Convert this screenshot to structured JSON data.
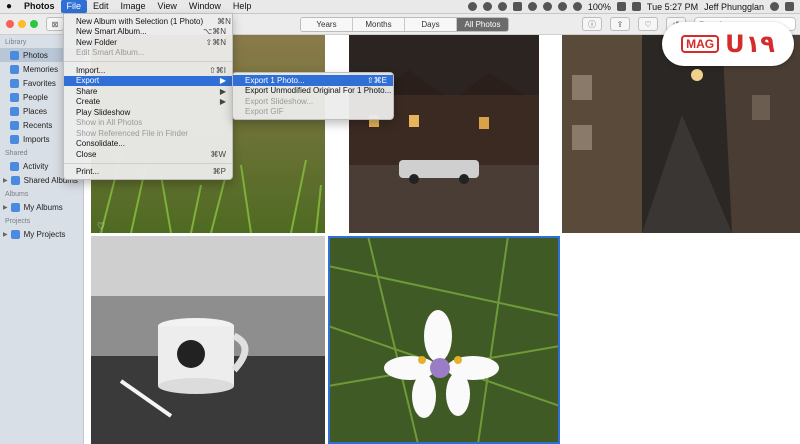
{
  "menubar": {
    "app_name": "Photos",
    "menus": [
      "File",
      "Edit",
      "Image",
      "View",
      "Window",
      "Help"
    ],
    "battery": "100%",
    "clock": "Tue 5:27 PM",
    "user": "Jeff Phungglan"
  },
  "toolbar": {
    "view_tabs": [
      "Years",
      "Months",
      "Days",
      "All Photos"
    ],
    "selected_tab": "All Photos",
    "search_placeholder": "Search"
  },
  "sidebar": {
    "library_heading": "Library",
    "library_items": [
      {
        "label": "Photos",
        "icon": "photos-icon",
        "selected": true
      },
      {
        "label": "Memories",
        "icon": "memories-icon"
      },
      {
        "label": "Favorites",
        "icon": "heart-icon"
      },
      {
        "label": "People",
        "icon": "people-icon"
      },
      {
        "label": "Places",
        "icon": "places-icon"
      },
      {
        "label": "Recents",
        "icon": "clock-icon"
      },
      {
        "label": "Imports",
        "icon": "imports-icon"
      }
    ],
    "shared_heading": "Shared",
    "shared_items": [
      {
        "label": "Activity",
        "icon": "cloud-icon"
      },
      {
        "label": "Shared Albums",
        "icon": "folder-icon",
        "expandable": true
      }
    ],
    "albums_heading": "Albums",
    "albums_items": [
      {
        "label": "My Albums",
        "icon": "folder-icon",
        "expandable": true
      }
    ],
    "projects_heading": "Projects",
    "projects_items": [
      {
        "label": "My Projects",
        "icon": "folder-icon",
        "expandable": true
      }
    ]
  },
  "file_menu": {
    "items": [
      {
        "label": "New Album with Selection (1 Photo)",
        "shortcut": "⌘N"
      },
      {
        "label": "New Smart Album...",
        "shortcut": "⌥⌘N"
      },
      {
        "label": "New Folder",
        "shortcut": "⇧⌘N"
      },
      {
        "label": "Edit Smart Album...",
        "shortcut": "",
        "disabled": true
      },
      {
        "separator": true
      },
      {
        "label": "Import...",
        "shortcut": "⇧⌘I"
      },
      {
        "label": "Export",
        "shortcut": "▶",
        "highlighted": true
      },
      {
        "label": "Share",
        "shortcut": "▶"
      },
      {
        "label": "Create",
        "shortcut": "▶"
      },
      {
        "label": "Play Slideshow",
        "shortcut": ""
      },
      {
        "label": "Show in All Photos",
        "shortcut": "",
        "disabled": true
      },
      {
        "label": "Show Referenced File in Finder",
        "shortcut": "",
        "disabled": true
      },
      {
        "label": "Consolidate...",
        "shortcut": ""
      },
      {
        "label": "Close",
        "shortcut": "⌘W"
      },
      {
        "separator": true
      },
      {
        "label": "Print...",
        "shortcut": "⌘P"
      }
    ]
  },
  "export_submenu": {
    "items": [
      {
        "label": "Export 1 Photo...",
        "shortcut": "⇧⌘E",
        "highlighted": true
      },
      {
        "label": "Export Unmodified Original For 1 Photo...",
        "shortcut": ""
      },
      {
        "label": "Export Slideshow...",
        "shortcut": "",
        "disabled": true
      },
      {
        "label": "Export GIF",
        "shortcut": "",
        "disabled": true
      }
    ]
  },
  "logo": {
    "mag": "MAG",
    "brand": "U۱۹"
  },
  "colors": {
    "accent": "#2f6fd6",
    "sidebar_bg": "#d9dfe6",
    "menubar_bg": "#e9e9e9"
  }
}
